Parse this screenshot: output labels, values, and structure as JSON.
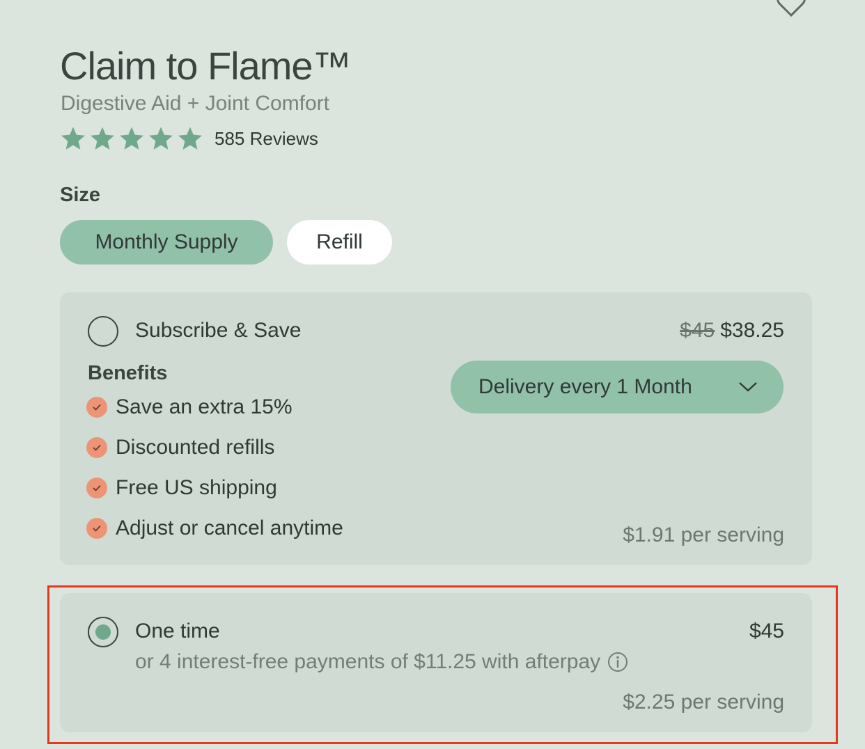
{
  "product": {
    "title": "Claim to Flame™",
    "subtitle": "Digestive Aid + Joint Comfort",
    "rating": 5,
    "reviews_label": "585 Reviews"
  },
  "size": {
    "label": "Size",
    "options": [
      "Monthly Supply",
      "Refill"
    ],
    "selected": "Monthly Supply"
  },
  "subscribe": {
    "label": "Subscribe & Save",
    "original_price": "$45",
    "price": "$38.25",
    "benefits_title": "Benefits",
    "benefits": [
      "Save an extra 15%",
      "Discounted refills",
      "Free US shipping",
      "Adjust or cancel anytime"
    ],
    "delivery_label": "Delivery every 1 Month",
    "per_serving": "$1.91 per serving",
    "selected": false
  },
  "one_time": {
    "label": "One time",
    "price": "$45",
    "afterpay_text": "or 4 interest-free payments of $11.25 with afterpay",
    "per_serving": "$2.25 per serving",
    "selected": true
  },
  "colors": {
    "background": "#dce4de",
    "card": "#cfdbd3",
    "accent": "#92c1aa",
    "star": "#6fa88b",
    "check": "#ec9475",
    "highlight": "#e4391e"
  }
}
